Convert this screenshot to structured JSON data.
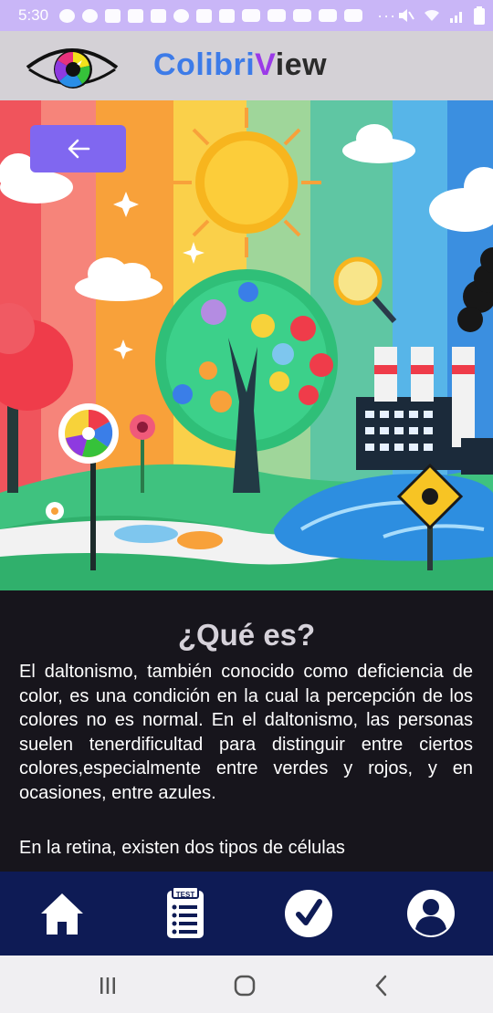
{
  "status_bar": {
    "time": "5:30",
    "icons": [
      "notification-icon",
      "settings-icon",
      "instagram-icon",
      "chat-icon",
      "message-icon",
      "app-icon",
      "app-icon",
      "app-icon",
      "youtube-icon",
      "youtube-icon",
      "youtube-icon",
      "youtube-icon",
      "youtube-icon",
      "more-dots-icon"
    ],
    "right_icons": [
      "mute-icon",
      "wifi-icon",
      "signal-icon",
      "battery-icon"
    ],
    "dots": "···"
  },
  "header": {
    "brand_part1": "Colibri",
    "brand_part2": "V",
    "brand_part3": "iew",
    "brand_colors": {
      "C": "#3d7be8",
      "V": "#9b3ae8",
      "rest": "#2b2b2b"
    }
  },
  "hero": {
    "back_icon": "arrow-left-icon",
    "back_button_color": "#8067f0",
    "illustration": "color-blindness-landscape"
  },
  "article": {
    "title": "¿Qué es?",
    "paragraph1": "El daltonismo, también conocido como deficiencia de color, es una condición en la cual la percepción de los colores no es normal. En el daltonismo, las personas suelen tenerdificultad para distinguir entre ciertos colores,especialmente entre verdes y rojos, y en ocasiones, entre azules.",
    "paragraph2": "En la retina, existen dos tipos de células"
  },
  "bottom_nav": {
    "items": [
      {
        "icon": "home-icon"
      },
      {
        "icon": "test-icon",
        "badge": "TEST"
      },
      {
        "icon": "checkmark-icon"
      },
      {
        "icon": "profile-icon"
      }
    ],
    "background": "#0e1b55"
  },
  "system_nav": {
    "items": [
      "recent-apps-icon",
      "home-circle-icon",
      "back-chevron-icon"
    ]
  }
}
